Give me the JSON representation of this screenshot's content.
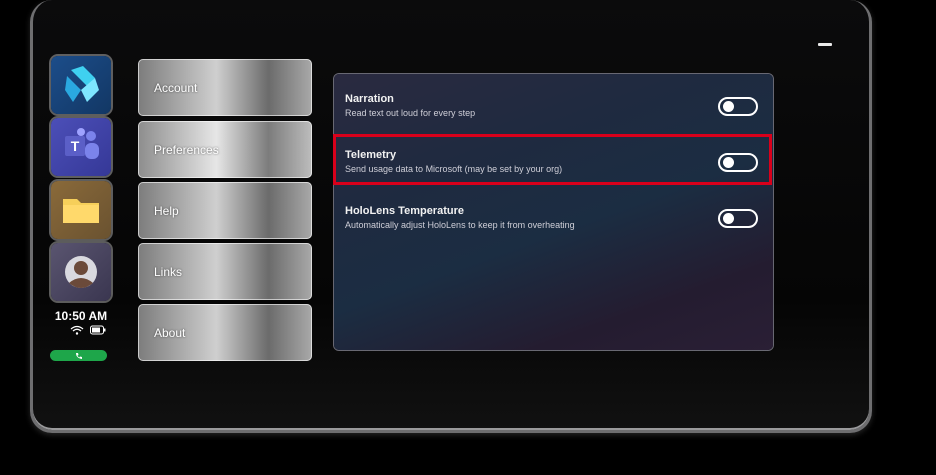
{
  "nav": {
    "items": [
      {
        "label": "Account"
      },
      {
        "label": "Preferences"
      },
      {
        "label": "Help"
      },
      {
        "label": "Links"
      },
      {
        "label": "About"
      }
    ],
    "selected": "Preferences"
  },
  "status": {
    "time": "10:50 AM"
  },
  "settings": [
    {
      "title": "Narration",
      "description": "Read text out loud for every step",
      "enabled": false
    },
    {
      "title": "Telemetry",
      "description": "Send usage data to Microsoft (may be set by your org)",
      "enabled": false,
      "highlighted": true
    },
    {
      "title": "HoloLens Temperature",
      "description": "Automatically adjust HoloLens to keep it from overheating",
      "enabled": false
    }
  ],
  "colors": {
    "highlight": "#d9001b",
    "call": "#1ea64a"
  },
  "icons": {
    "apps": [
      "dynamics-guides-icon",
      "teams-icon",
      "files-icon",
      "avatar"
    ],
    "status": [
      "wifi-icon",
      "battery-icon",
      "phone-icon"
    ]
  }
}
